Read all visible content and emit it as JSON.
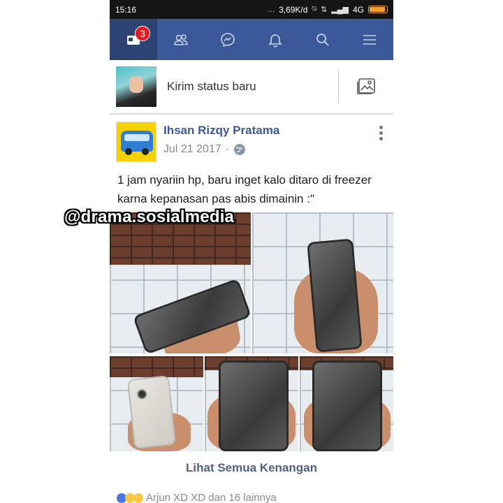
{
  "status_bar": {
    "time": "15:16",
    "dots": "...",
    "speed": "3,69K/d",
    "network": "4G"
  },
  "nav": {
    "items": [
      {
        "name": "news-feed",
        "icon": "news-feed-icon",
        "badge": "3",
        "active": true
      },
      {
        "name": "friends",
        "icon": "friends-icon"
      },
      {
        "name": "messenger",
        "icon": "messenger-icon"
      },
      {
        "name": "notifications",
        "icon": "bell-icon"
      },
      {
        "name": "search",
        "icon": "search-icon"
      },
      {
        "name": "menu",
        "icon": "hamburger-menu-icon"
      }
    ]
  },
  "composer": {
    "placeholder": "Kirim status baru",
    "photo_icon": "photo-icon"
  },
  "post": {
    "author": "Ihsan Rizqy Pratama",
    "date": "Jul 21 2017",
    "separator": "·",
    "privacy_icon": "globe-icon",
    "text": "1 jam nyariin hp, baru inget kalo ditaro di freezer karna kepanasan pas abis dimainin :\"",
    "watermark": "@drama.sosialmedia",
    "photo_count": 5
  },
  "memories_link": "Lihat Semua Kenangan",
  "reactions_text": "Arjun XD XD dan 16 lainnya",
  "colors": {
    "fb_blue": "#3b5998",
    "badge_red": "#e41b23",
    "link_blue": "#506084"
  }
}
